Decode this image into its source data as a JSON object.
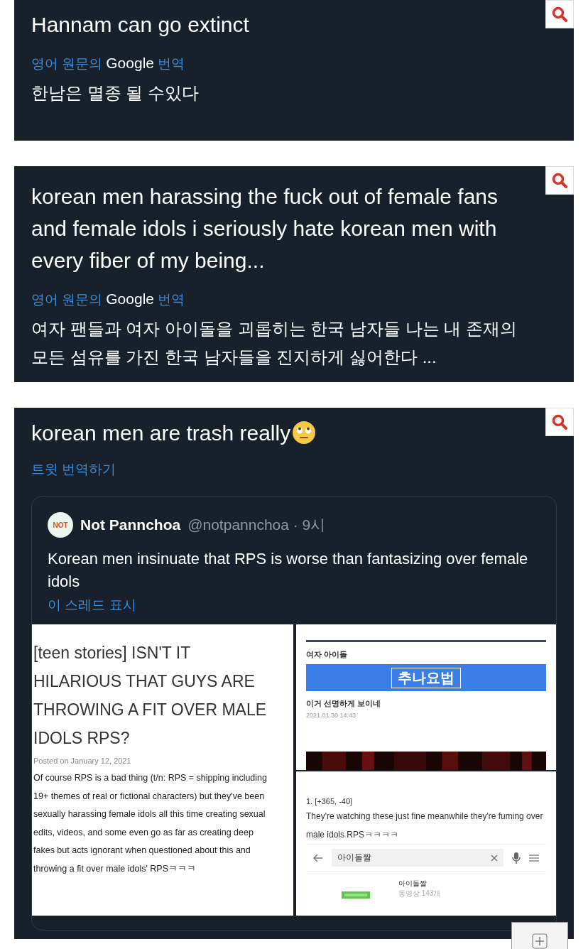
{
  "posts": [
    {
      "kind": "translated",
      "text": "Hannam can go extinct",
      "translation_label": {
        "before": "영어 원문의",
        "brand": "Google",
        "after": "번역"
      },
      "translation": "한남은 멸종 될 수있다"
    },
    {
      "kind": "translated",
      "text": "korean men harassing the fuck out of female fans and female idols i seriously hate korean men with every fiber of my being...",
      "translation_label": {
        "before": "영어 원문의",
        "brand": "Google",
        "after": "번역"
      },
      "translation": "여자 팬들과 여자 아이돌을 괴롭히는 한국 남자들 나는 내 존재의 모든 섬유를 가진 한국 남자들을 진지하게 싫어한다 ..."
    },
    {
      "kind": "quote",
      "text": "korean men are trash really",
      "translate_link": "트윗 번역하기",
      "quoted_tweet": {
        "avatar_text": "NOT",
        "name": "Not Pannchoa",
        "meta": "@notpannchoa · 9시",
        "text": "Korean men insinuate that RPS is worse than fantasizing over female idols",
        "show_thread": "이 스레드 표시",
        "article": {
          "title": "[teen stories] ISN'T IT HILARIOUS THAT GUYS ARE THROWING A FIT OVER MALE IDOLS RPS?",
          "date": "Posted on January 12, 2021",
          "body": "Of course RPS is a bad thing (t/n: RPS = shipping including 19+ themes of real or fictional characters) but they've been sexually harassing female idols all this time creating sexual edits, videos, and some even go as far as creating deep fakes but acts ignorant when questioned about this and throwing a fit over male idols' RPSㅋㅋㅋ"
        },
        "board_post": {
          "board": "여자 아이돌",
          "banner": "추나요법",
          "title": "이거 선명하게 보이네",
          "date": "2021.01.30 14:43"
        },
        "comment": {
          "index": "1. [+365, -40]",
          "text": "They're watching these just fine meanwhile they're fuming over male idols RPSㅋㅋㅋㅋ",
          "search_query": "아이돌짤",
          "result_title": "아이돌짤",
          "result_meta": "동영상 143개"
        }
      }
    }
  ]
}
